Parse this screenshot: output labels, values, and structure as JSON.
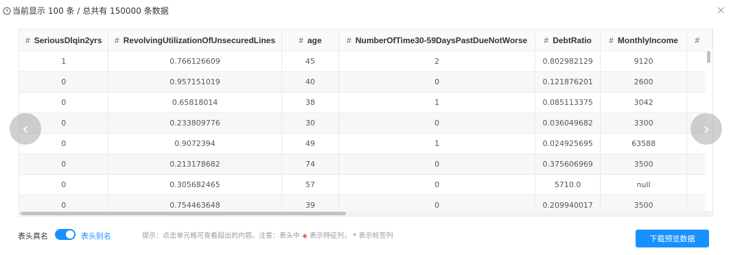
{
  "header": {
    "info_text": "当前显示 100 条 / 总共有 150000 条数据",
    "close_glyph": "×"
  },
  "table": {
    "hash": "#",
    "columns": [
      "SeriousDlqin2yrs",
      "RevolvingUtilizationOfUnsecuredLines",
      "age",
      "NumberOfTime30-59DaysPastDueNotWorse",
      "DebtRatio",
      "MonthlyIncome",
      ""
    ],
    "rows": [
      [
        "1",
        "0.766126609",
        "45",
        "2",
        "0.802982129",
        "9120",
        ""
      ],
      [
        "0",
        "0.957151019",
        "40",
        "0",
        "0.121876201",
        "2600",
        ""
      ],
      [
        "0",
        "0.65818014",
        "38",
        "1",
        "0.085113375",
        "3042",
        ""
      ],
      [
        "0",
        "0.233809776",
        "30",
        "0",
        "0.036049682",
        "3300",
        ""
      ],
      [
        "0",
        "0.9072394",
        "49",
        "1",
        "0.024925695",
        "63588",
        ""
      ],
      [
        "0",
        "0.213178682",
        "74",
        "0",
        "0.375606969",
        "3500",
        ""
      ],
      [
        "0",
        "0.305682465",
        "57",
        "0",
        "5710.0",
        "null",
        ""
      ],
      [
        "0",
        "0.754463648",
        "39",
        "0",
        "0.209940017",
        "3500",
        ""
      ]
    ]
  },
  "nav": {
    "prev": "‹",
    "next": "›"
  },
  "footer": {
    "label_real": "表头真名",
    "label_alias": "表头别名",
    "hint_a": "提示：点击单元格可查看超出的内容。注意：表头中",
    "hint_b": "表示特征列，",
    "hint_star": "*",
    "hint_c": "表示标签列",
    "download": "下载预览数据"
  },
  "colors": {
    "accent": "#1890ff",
    "red": "#e8453c"
  }
}
